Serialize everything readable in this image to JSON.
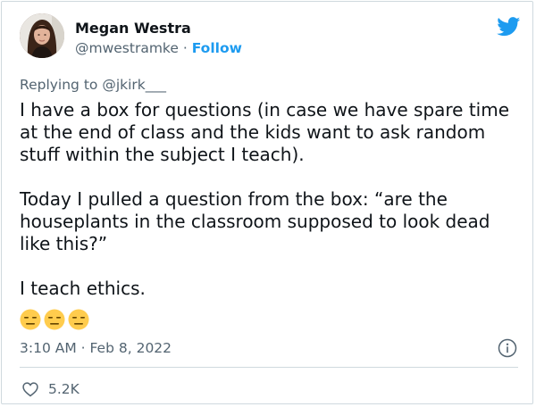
{
  "author": {
    "name": "Megan Westra",
    "handle": "@mwestramke",
    "separator": "·",
    "follow_label": "Follow"
  },
  "reply": {
    "prefix": "Replying to",
    "mention": "@jkirk___"
  },
  "tweet": {
    "paragraphs": [
      "I have a box for questions (in case we have spare time at the end of class and the kids want to ask random stuff within the subject I teach).",
      "Today I pulled a question from the box: “are the houseplants in the classroom supposed to look dead like this?”",
      "I teach ethics."
    ],
    "emojis": [
      "expressionless-face-emoji",
      "expressionless-face-emoji",
      "expressionless-face-emoji"
    ]
  },
  "timestamp": "3:10 AM · Feb 8, 2022",
  "likes": "5.2K",
  "icons": {
    "brand": "twitter-bird-icon",
    "info": "info-icon",
    "like": "heart-icon"
  },
  "colors": {
    "brand_blue": "#1d9bf0",
    "secondary_text": "#536471",
    "primary_text": "#0f1419",
    "border": "#cfd9de",
    "emoji_face": "#ffcc4d"
  }
}
